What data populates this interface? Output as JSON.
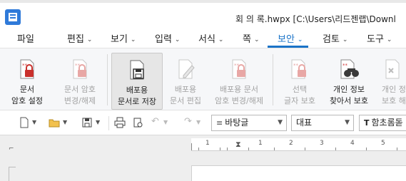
{
  "window": {
    "title": "회 의 록.hwpx [C:\\Users\\리드젠랩\\Downl"
  },
  "menu": {
    "items": [
      "파일",
      "편집",
      "보기",
      "입력",
      "서식",
      "쪽",
      "보안",
      "검토",
      "도구"
    ],
    "active": "보안"
  },
  "ribbon": {
    "buttons": [
      {
        "line1": "문서",
        "line2": "암호 설정",
        "enabled": true,
        "icon": "document-lock-icon"
      },
      {
        "line1": "문서 암호",
        "line2": "변경/해제",
        "enabled": false,
        "icon": "document-lock-change-icon"
      },
      {
        "line1": "배포용",
        "line2": "문서로 저장",
        "enabled": true,
        "icon": "save-distribution-icon",
        "selected": true
      },
      {
        "line1": "배포용",
        "line2": "문서 편집",
        "enabled": false,
        "icon": "distribution-edit-icon"
      },
      {
        "line1": "배포용 문서",
        "line2": "암호 변경/해제",
        "enabled": false,
        "icon": "distribution-password-icon"
      },
      {
        "line1": "선택",
        "line2": "글자 보호",
        "enabled": false,
        "icon": "text-protect-icon"
      },
      {
        "line1": "개인 정보",
        "line2": "찾아서 보호",
        "enabled": true,
        "icon": "privacy-search-icon"
      },
      {
        "line1": "개인 정보",
        "line2": "보호 해제",
        "enabled": false,
        "icon": "privacy-unprotect-icon"
      }
    ]
  },
  "toolbar": {
    "style_value": "바탕글",
    "lang_value": "대표",
    "font_value": "함초롬돋"
  },
  "ruler": {
    "numbers": [
      "1",
      "1",
      "2",
      "3",
      "4",
      "5"
    ]
  },
  "colors": {
    "accent": "#1a73c8",
    "ribbon_bg": "#f6f7f9",
    "disabled_text": "#a3a3a3"
  }
}
